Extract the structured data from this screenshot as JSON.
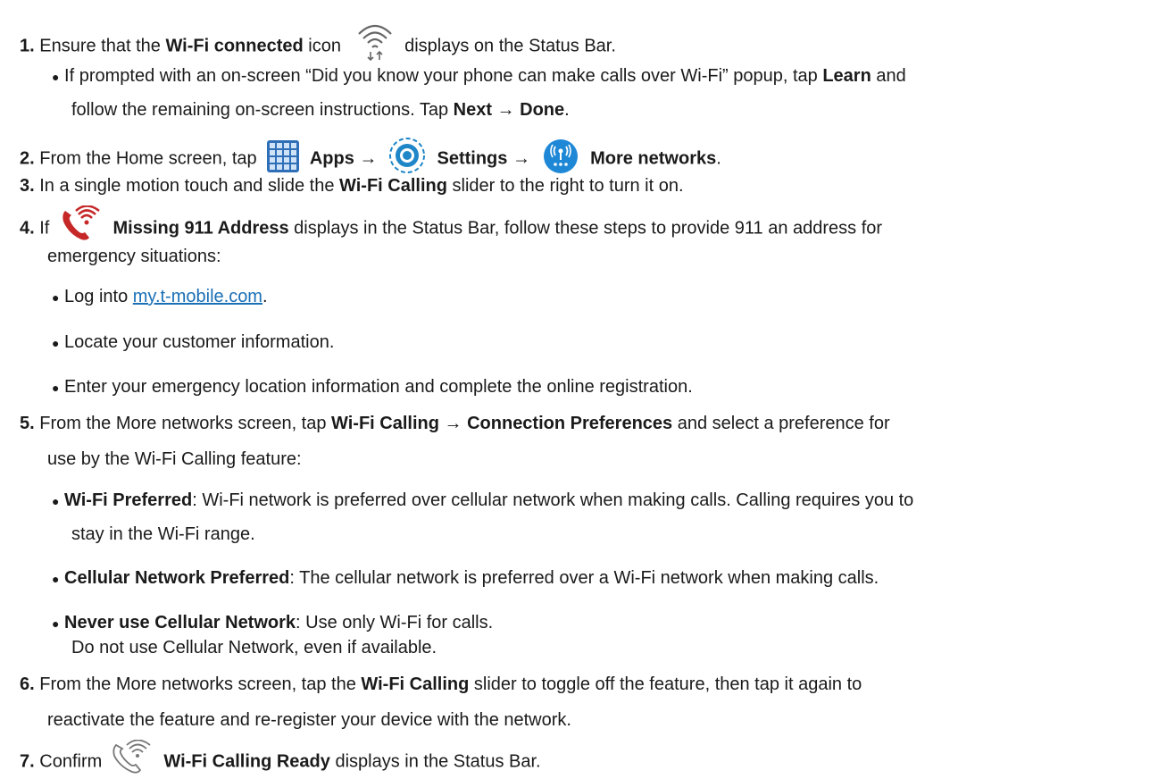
{
  "steps": {
    "s1": {
      "num": "1.",
      "a": "Ensure that the ",
      "b": "Wi-Fi connected",
      "c": " icon",
      "d": "displays on the Status Bar."
    },
    "s1b": {
      "a": "If prompted with an on-screen “Did you know your phone can make calls over Wi-Fi” popup, tap ",
      "b": "Learn",
      "c": " and"
    },
    "s1b2": {
      "a": "follow the remaining on-screen instructions. Tap ",
      "b": "Next",
      "arrow": " → ",
      "c": "Done",
      "d": "."
    },
    "s2": {
      "num": "2.",
      "a": "From the Home screen, tap",
      "apps": "Apps",
      "arrow": "→",
      "settings": "Settings",
      "more": "More networks",
      "end": "."
    },
    "s3": {
      "num": "3.",
      "a": "In a single motion touch and slide the ",
      "b": "Wi-Fi Calling",
      "c": " slider to the right to turn it on."
    },
    "s4": {
      "num": "4.",
      "a": "If",
      "b": "Missing 911 Address",
      "c": " displays in the Status Bar, follow these steps to provide 911 an address for"
    },
    "s4cont": "emergency situations:",
    "b1": {
      "a": "Log into ",
      "link": "my.t-mobile.com",
      "end": "."
    },
    "b2": "Locate your customer information.",
    "b3": "Enter your emergency location information and complete the online registration.",
    "s5": {
      "num": "5.",
      "a": "From the More networks screen, tap ",
      "b": "Wi-Fi Calling",
      "arrow": " → ",
      "c": "Connection Preferences",
      "d": " and select a preference for"
    },
    "s5cont": "use by the Wi-Fi Calling feature:",
    "p1": {
      "b": "Wi-Fi Preferred",
      "a": ": Wi-Fi network is preferred over cellular network when making calls. Calling requires you to"
    },
    "p1cont": "stay in the Wi-Fi range.",
    "p2": {
      "b": "Cellular Network Preferred",
      "a": ": The cellular network is preferred over a Wi-Fi network when making calls."
    },
    "p3": {
      "b": "Never use Cellular Network",
      "a": ": Use only Wi-Fi for calls."
    },
    "p3cont": "Do not use Cellular Network, even if available.",
    "s6": {
      "num": "6.",
      "a": "From the More networks screen, tap the ",
      "b": "Wi-Fi Calling",
      "c": " slider to toggle off the feature, then tap it again to"
    },
    "s6cont": "reactivate the feature and re-register your device with the network.",
    "s7": {
      "num": "7.",
      "a": "Confirm",
      "b": "Wi-Fi Calling Ready",
      "c": " displays in the Status Bar."
    }
  },
  "bullet": "●",
  "colors": {
    "link": "#1a6fb5",
    "apps_icon": "#2f6fb8",
    "settings_icon": "#1f86c8",
    "more_icon": "#1e88d6",
    "phone_red": "#c62828"
  }
}
